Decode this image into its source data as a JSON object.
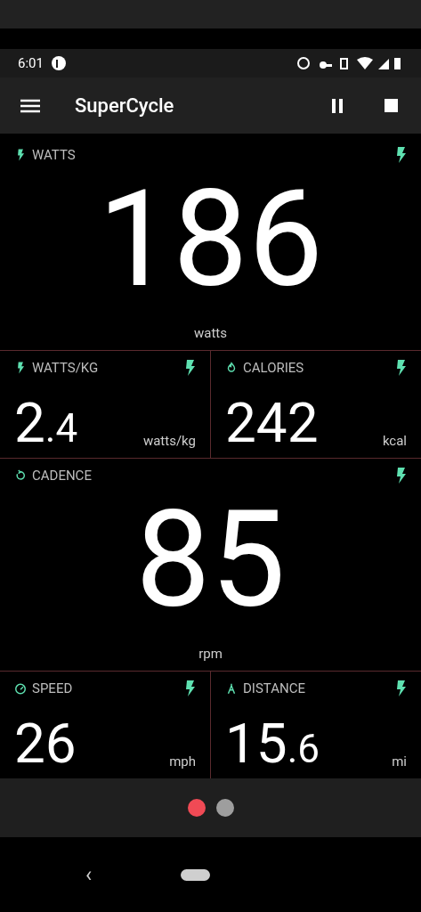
{
  "status_bar": {
    "time": "6:01"
  },
  "app_bar": {
    "title": "SuperCycle"
  },
  "rows": [
    {
      "tiles": [
        {
          "kind": "large",
          "label": "WATTS",
          "value": "186",
          "unit": "watts"
        }
      ]
    },
    {
      "tiles": [
        {
          "kind": "small",
          "label": "WATTS/KG",
          "value": "2",
          "decimal": ".4",
          "unit": "watts/kg"
        },
        {
          "kind": "small",
          "label": "CALORIES",
          "value": "242",
          "unit": "kcal"
        }
      ]
    },
    {
      "tiles": [
        {
          "kind": "large",
          "label": "CADENCE",
          "value": "85",
          "unit": "rpm"
        }
      ]
    },
    {
      "tiles": [
        {
          "kind": "small",
          "label": "SPEED",
          "value": "26",
          "unit": "mph"
        },
        {
          "kind": "small",
          "label": "DISTANCE",
          "value": "15",
          "decimal": ".6",
          "unit": "mi"
        }
      ]
    }
  ],
  "pager": [
    {
      "selected": true
    },
    {
      "selected": false
    }
  ],
  "nav_bar": {
    "back": "‹"
  }
}
